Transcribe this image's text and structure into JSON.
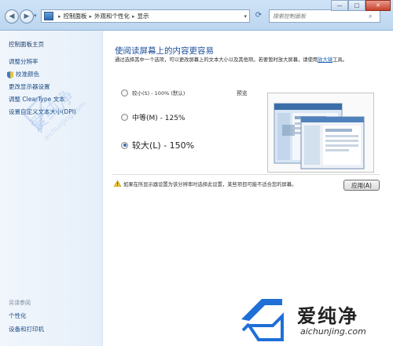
{
  "window": {
    "breadcrumb": [
      "控制面板",
      "外观和个性化",
      "显示"
    ],
    "search_placeholder": "搜索控制面板",
    "controls": {
      "minimize": "—",
      "maximize": "□",
      "close": "✕"
    }
  },
  "sidebar": {
    "home": "控制面板主页",
    "items": [
      "调整分辨率",
      "校准颜色",
      "更改显示器设置",
      "调整 ClearType 文本",
      "设置自定义文本大小(DPI)"
    ],
    "see_also_label": "另请参阅",
    "see_also": [
      "个性化",
      "设备和打印机"
    ]
  },
  "main": {
    "heading": "使阅读屏幕上的内容更容易",
    "description": "通过选择其中一个选项，可以更改屏幕上的文本大小以及其他项。若要暂时放大屏幕，请使用",
    "link_text": "放大镜",
    "description_tail": "工具。",
    "options": [
      {
        "label": "较小(S) - 100% (默认)",
        "selected": false
      },
      {
        "label": "中等(M) - 125%",
        "selected": false
      },
      {
        "label": "较大(L) - 150%",
        "selected": true
      }
    ],
    "preview_label": "预览",
    "warning": "如果在所显示器设置为该分辨率时选择此设置，某些项目可能不适合您的屏幕。",
    "apply_button": "应用(A)"
  },
  "watermark": {
    "brand": "爱纯净",
    "url": "aichunjing.com",
    "side_text": "爱纯净",
    "side_url": "aichunjing.com"
  },
  "colors": {
    "heading": "#1d4f9a",
    "link": "#1b4c86",
    "chrome": "#cfe3f7"
  }
}
